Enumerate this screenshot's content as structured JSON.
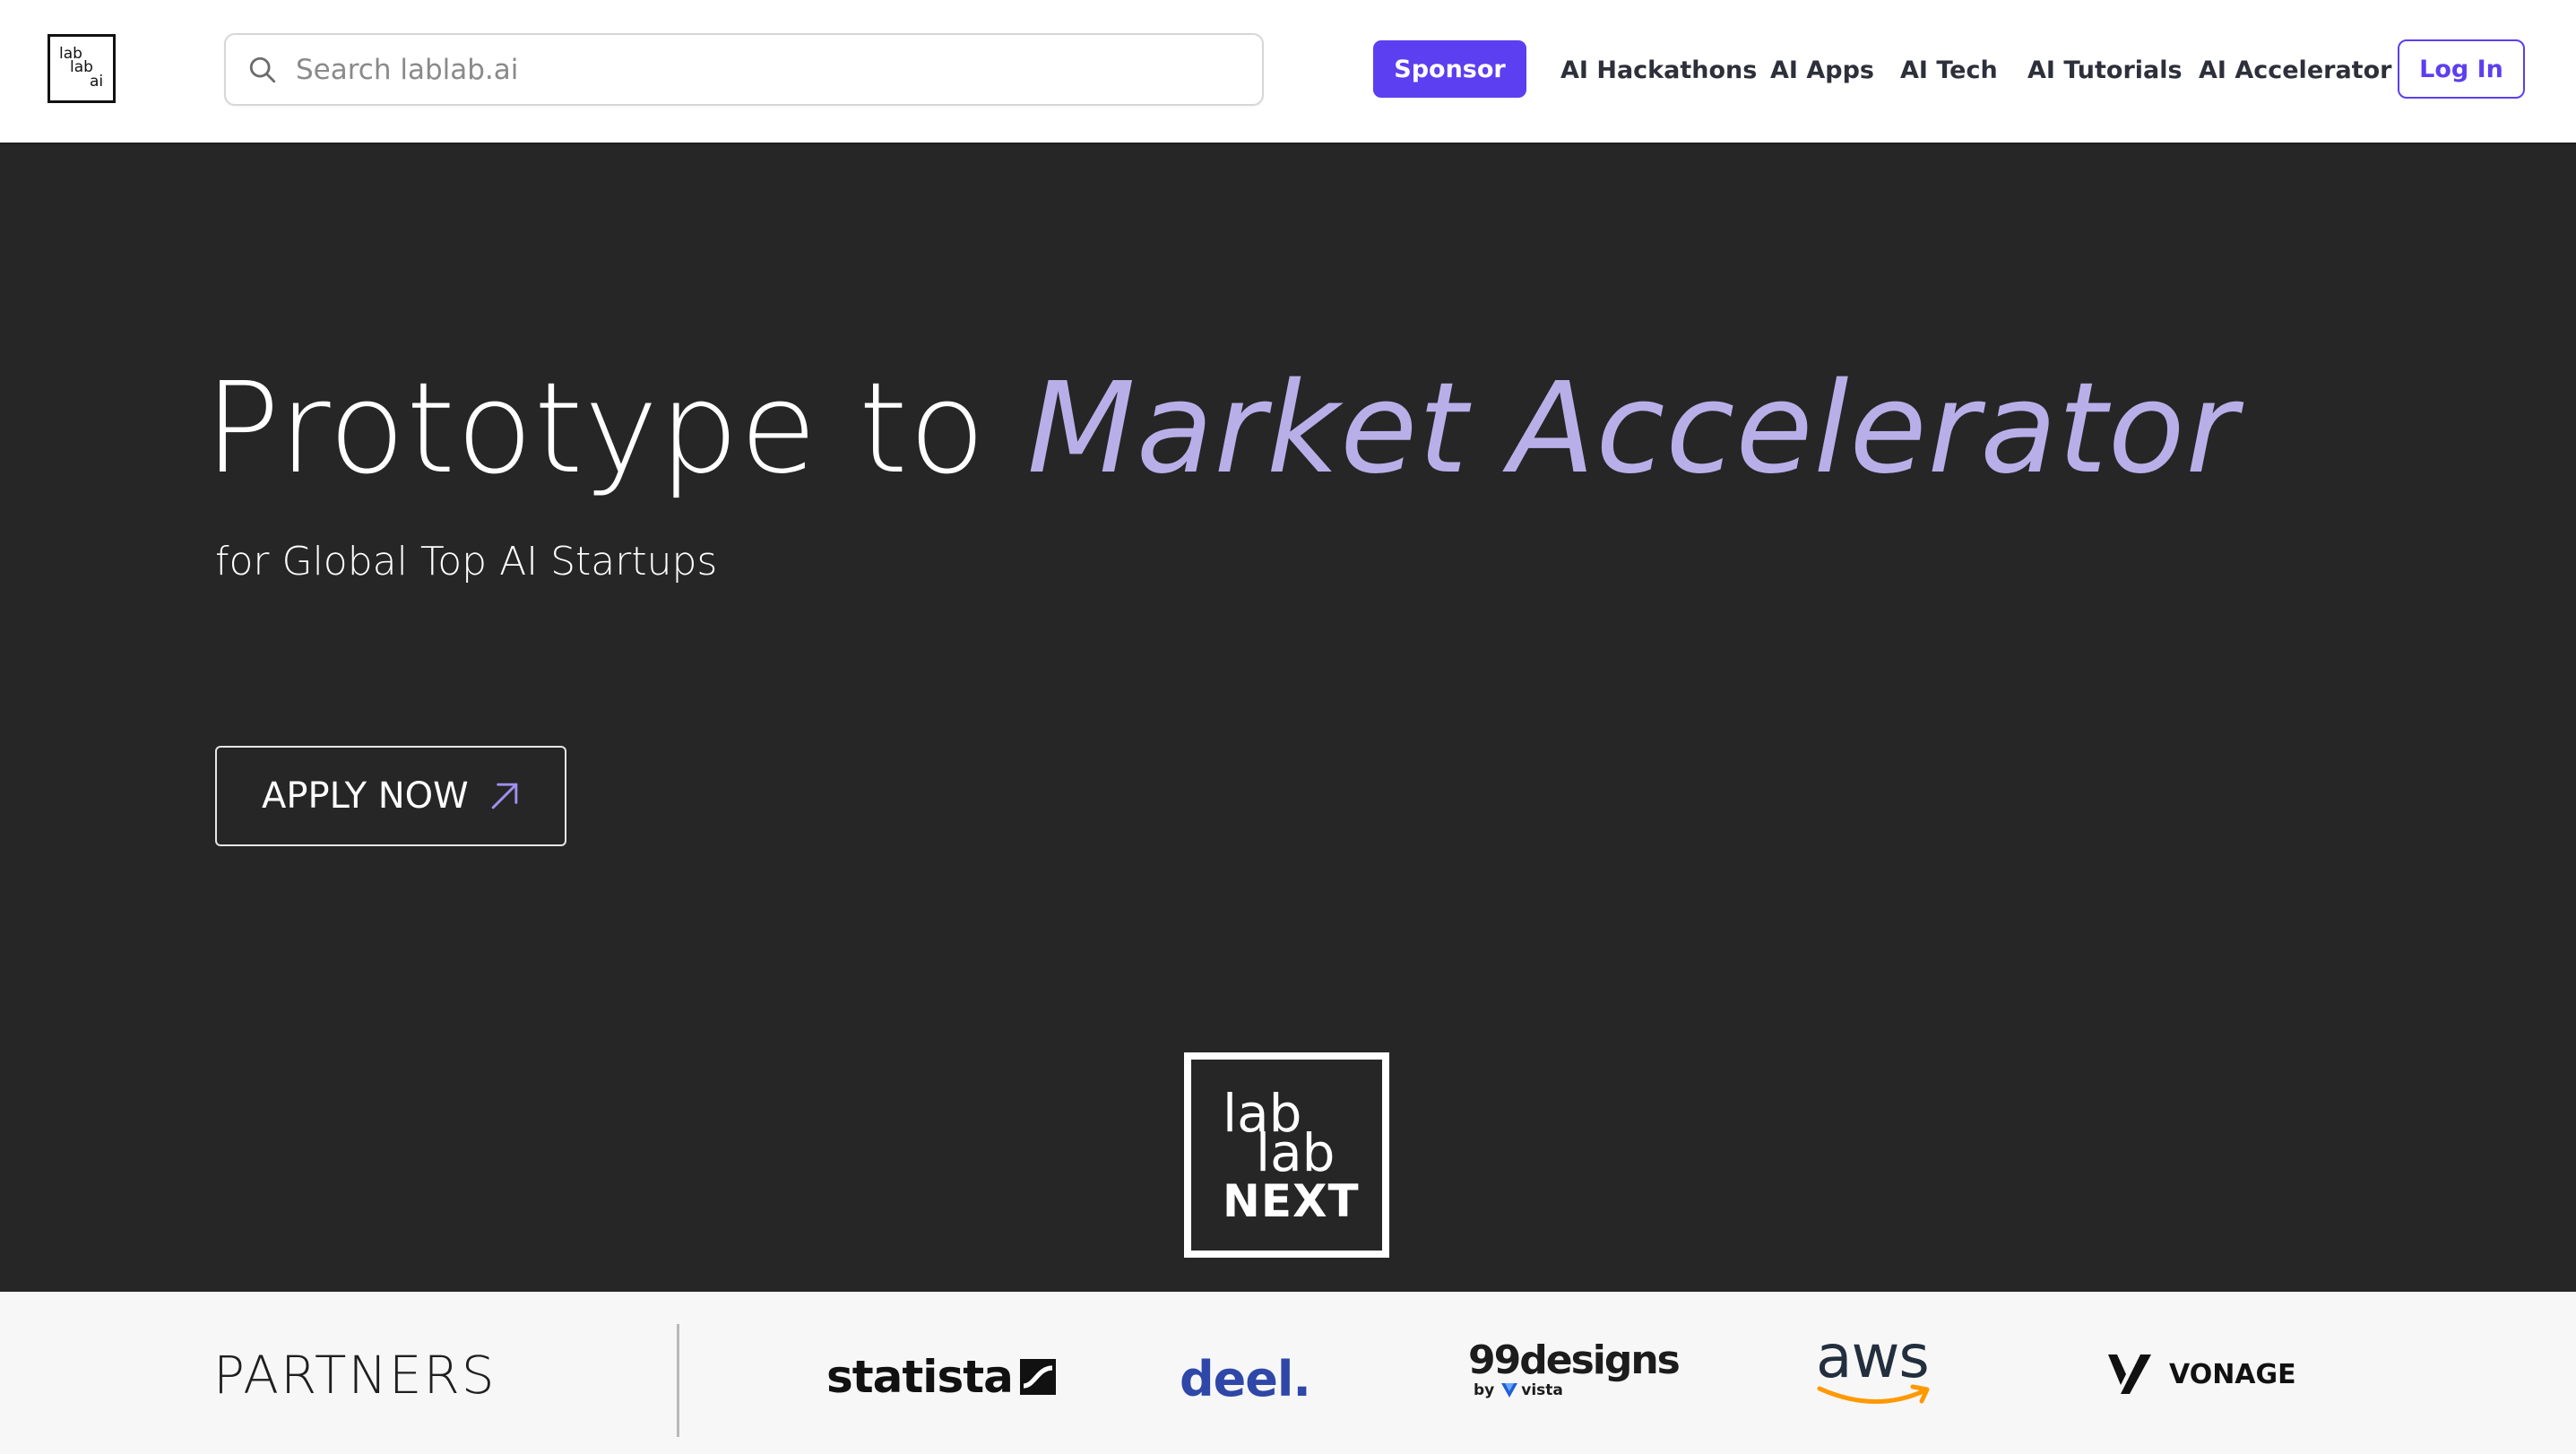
{
  "header": {
    "logo": {
      "lines": [
        "lab",
        "lab",
        "ai"
      ]
    },
    "search": {
      "placeholder": "Search lablab.ai",
      "value": ""
    },
    "sponsor_label": "Sponsor",
    "nav": [
      {
        "label": "AI Hackathons"
      },
      {
        "label": "AI Apps"
      },
      {
        "label": "AI Tech"
      },
      {
        "label": "AI Tutorials"
      },
      {
        "label": "AI Accelerator"
      }
    ],
    "login_label": "Log In"
  },
  "hero": {
    "title_plain": "Prototype to ",
    "title_accent": "Market Accelerator",
    "subtitle": "for Global Top AI Startups",
    "apply_label": "APPLY NOW",
    "next_logo": {
      "line1": "lab",
      "line2": "lab",
      "line3": "NEXT"
    }
  },
  "partners": {
    "title": "PARTNERS",
    "logos": [
      {
        "name": "statista",
        "text": "statista"
      },
      {
        "name": "deel",
        "text": "deel."
      },
      {
        "name": "99designs",
        "text": "99designs",
        "sub_by": "by",
        "sub_brand": "vista"
      },
      {
        "name": "aws",
        "text": "aws"
      },
      {
        "name": "vonage",
        "text": "VONAGE"
      }
    ]
  },
  "colors": {
    "accent": "#5b3ff0",
    "hero_bg": "#262626",
    "title_accent": "#b9afe8",
    "deel_blue": "#2e47a8",
    "aws_orange": "#ff9900"
  },
  "icons": [
    "search-icon",
    "arrow-up-right-icon"
  ]
}
